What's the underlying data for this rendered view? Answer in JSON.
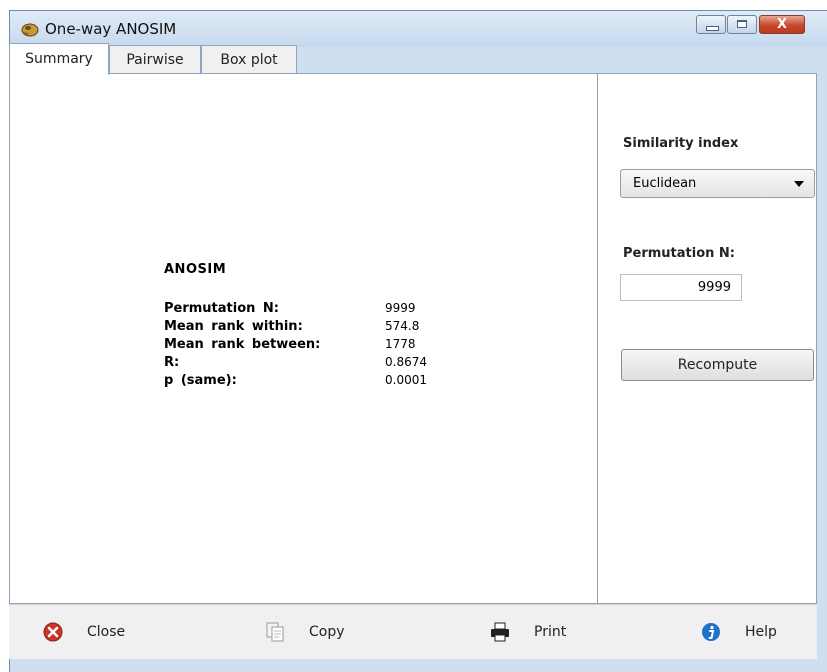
{
  "window": {
    "title": "One-way ANOSIM",
    "close_glyph": "X"
  },
  "tabs": [
    {
      "label": "Summary",
      "active": true
    },
    {
      "label": "Pairwise",
      "active": false
    },
    {
      "label": "Box plot",
      "active": false
    }
  ],
  "results": {
    "title": "ANOSIM",
    "rows": [
      {
        "label": "Permutation N:",
        "value": "9999"
      },
      {
        "label": "Mean rank within:",
        "value": "574.8"
      },
      {
        "label": "Mean rank between:",
        "value": "1778"
      },
      {
        "label": "R:",
        "value": "0.8674"
      },
      {
        "label": "p (same):",
        "value": "0.0001"
      }
    ]
  },
  "options": {
    "similarity_label": "Similarity index",
    "similarity_value": "Euclidean",
    "permutation_label": "Permutation N:",
    "permutation_value": "9999",
    "recompute_label": "Recompute"
  },
  "toolbar": {
    "close_label": "Close",
    "copy_label": "Copy",
    "print_label": "Print",
    "help_label": "Help"
  },
  "colors": {
    "titlebar": "#c6d9ee",
    "close_button": "#c9472a",
    "help_icon": "#1e73c8"
  }
}
